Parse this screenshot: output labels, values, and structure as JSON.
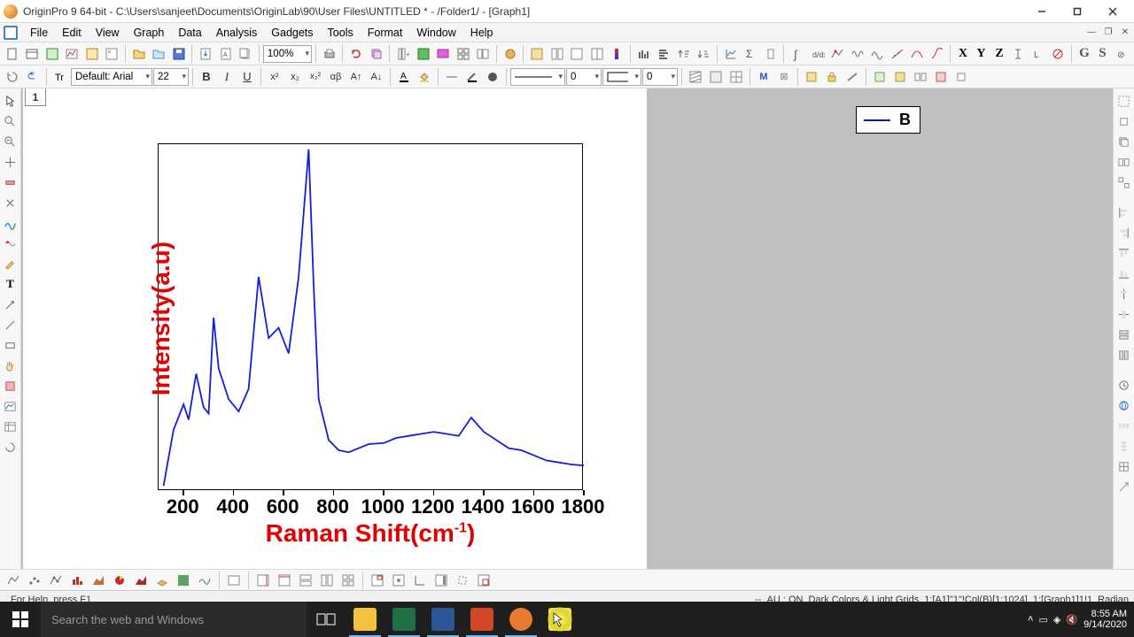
{
  "title": "OriginPro 9 64-bit - C:\\Users\\sanjeet\\Documents\\OriginLab\\90\\User Files\\UNTITLED * - /Folder1/ - [Graph1]",
  "menu": [
    "File",
    "Edit",
    "View",
    "Graph",
    "Data",
    "Analysis",
    "Gadgets",
    "Tools",
    "Format",
    "Window",
    "Help"
  ],
  "font": {
    "name": "Default: Arial",
    "size": "22"
  },
  "zoom": "100%",
  "tb2_num1": "0",
  "tb2_num2": "0",
  "tb2_num3": "0",
  "page_tab": "1",
  "legend_label": "B",
  "ylabel": "Intensity(a.u)",
  "xlabel_pre": "Raman Shift(cm",
  "xlabel_sup": "-1",
  "xlabel_post": ")",
  "chart_data": {
    "type": "line",
    "x_ticks": [
      200,
      400,
      600,
      800,
      1000,
      1200,
      1400,
      1600,
      1800
    ],
    "xlim": [
      100,
      1800
    ],
    "ylim": [
      0,
      3400
    ],
    "series": [
      {
        "name": "B",
        "x": [
          120,
          160,
          200,
          220,
          250,
          280,
          300,
          320,
          340,
          380,
          420,
          460,
          500,
          540,
          580,
          620,
          660,
          700,
          720,
          740,
          780,
          820,
          860,
          900,
          940,
          1000,
          1050,
          1100,
          1150,
          1200,
          1250,
          1300,
          1350,
          1400,
          1450,
          1500,
          1550,
          1600,
          1650,
          1700,
          1750,
          1800
        ],
        "y": [
          50,
          600,
          850,
          700,
          1150,
          820,
          760,
          1700,
          1200,
          900,
          780,
          1000,
          2100,
          1500,
          1600,
          1350,
          2100,
          3350,
          2000,
          900,
          500,
          400,
          380,
          420,
          460,
          470,
          520,
          540,
          560,
          580,
          560,
          540,
          720,
          580,
          500,
          420,
          400,
          350,
          300,
          280,
          260,
          250
        ]
      }
    ]
  },
  "status": {
    "help": "For Help, press F1",
    "au": "AU : ON",
    "theme": "Dark Colors & Light Grids",
    "sel": "1:[A1]\"1\"!Col(B)[1:1024]",
    "graph": "1:[Graph1]1!1",
    "angle": "Radian",
    "dash": "--"
  },
  "taskbar": {
    "search_placeholder": "Search the web and Windows"
  },
  "tray": {
    "time": "8:55 AM",
    "date": "9/14/2020"
  }
}
